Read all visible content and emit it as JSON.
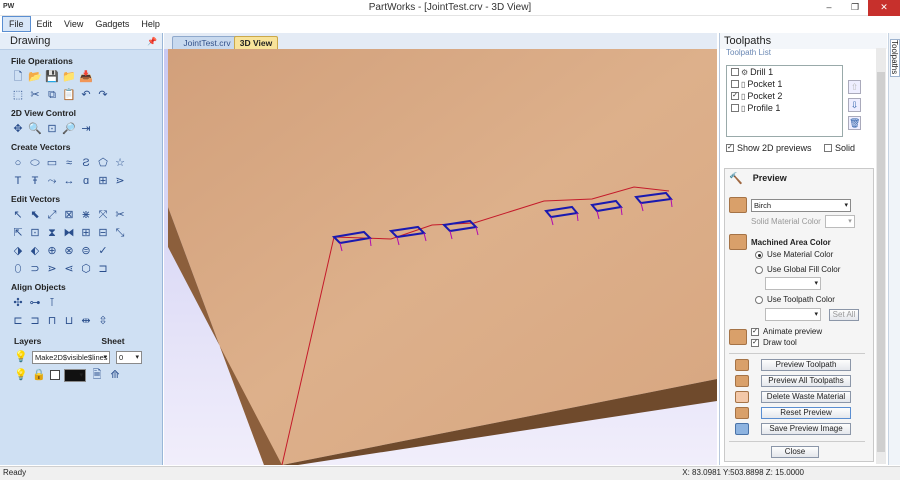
{
  "window": {
    "title": "PartWorks - [JointTest.crv - 3D View]",
    "app_badge": "PW",
    "min": "–",
    "max": "❐",
    "close": "✕"
  },
  "menu": [
    "File",
    "Edit",
    "View",
    "Gadgets",
    "Help"
  ],
  "drawing": {
    "title": "Drawing",
    "sections": {
      "file_ops": "File Operations",
      "view2d": "2D View Control",
      "create": "Create Vectors",
      "edit": "Edit Vectors",
      "align": "Align Objects"
    },
    "layers_label": "Layers",
    "sheet_label": "Sheet",
    "layer_value": "Make2D$visible$lines",
    "sheet_value": "0"
  },
  "tabs": [
    "JointTest.crv",
    "3D View"
  ],
  "toolpaths": {
    "title": "Toolpaths",
    "list_title": "Toolpath List",
    "items": [
      {
        "label": "Drill 1",
        "checked": false
      },
      {
        "label": "Pocket 1",
        "checked": false
      },
      {
        "label": "Pocket 2",
        "checked": true
      },
      {
        "label": "Profile 1",
        "checked": false
      }
    ],
    "show_2d": "Show 2D previews",
    "solid": "Solid",
    "vertical_tab": "Toolpaths"
  },
  "preview": {
    "title": "Preview",
    "material": "Birch",
    "solid_color_label": "Solid Material Color",
    "machined_label": "Machined Area Color",
    "use_material": "Use Material Color",
    "use_global": "Use Global Fill Color",
    "use_toolpath": "Use Toolpath Color",
    "set_all": "Set All",
    "animate": "Animate preview",
    "draw_tool": "Draw tool",
    "btn_preview": "Preview Toolpath",
    "btn_preview_all": "Preview All Toolpaths",
    "btn_delete": "Delete Waste Material",
    "btn_reset": "Reset Preview",
    "btn_save": "Save Preview Image",
    "btn_close": "Close"
  },
  "status": {
    "left": "Ready",
    "coords": "X: 83.0981 Y:503.8898 Z: 15.0000"
  },
  "colors": {
    "panel": "#cfe0f3",
    "wood": "#d8a47b",
    "toolpath": "#1a1ab0",
    "path_line": "#c41a2a"
  }
}
